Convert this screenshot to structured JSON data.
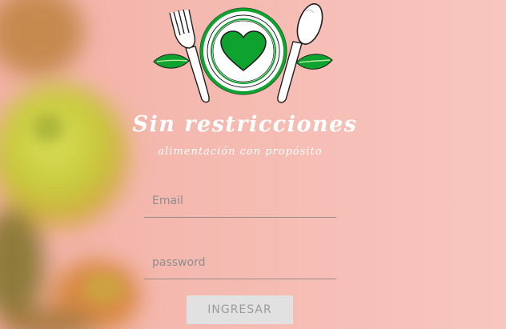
{
  "colors": {
    "background": "#f5c0b6",
    "brand_green": "#0ea32e",
    "text_light": "#ffffff",
    "button_bg": "#e1e1e1",
    "button_text": "#9b9b9b"
  },
  "brand": {
    "logo_icons": [
      "fork-icon",
      "plate-icon",
      "heart-icon",
      "spoon-icon",
      "leaf-icon"
    ],
    "title": "Sin restricciones",
    "tagline": "alimentación con  propósito"
  },
  "login_form": {
    "email": {
      "placeholder": "Email",
      "value": ""
    },
    "password": {
      "placeholder": "password",
      "value": ""
    },
    "submit_label": "INGRESAR"
  }
}
